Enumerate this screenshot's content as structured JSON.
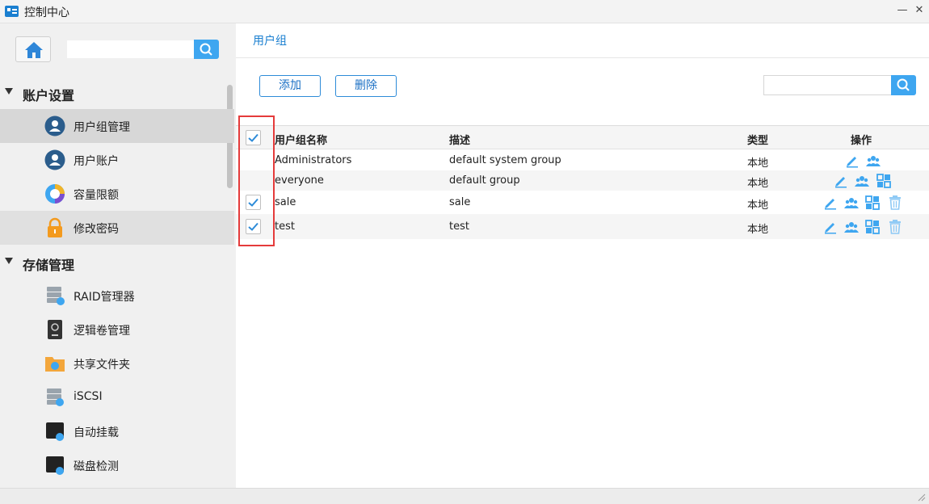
{
  "window": {
    "title": "控制中心",
    "minimize": "—",
    "close": "✕"
  },
  "sidebar": {
    "search": {
      "placeholder": ""
    },
    "sections": [
      {
        "label": "账户设置",
        "items": [
          {
            "label": "用户组管理",
            "icon": "user-group-icon",
            "state": "active"
          },
          {
            "label": "用户账户",
            "icon": "user-account-icon"
          },
          {
            "label": "容量限额",
            "icon": "quota-pie-icon"
          },
          {
            "label": "修改密码",
            "icon": "lock-icon",
            "state": "highlighted"
          }
        ]
      },
      {
        "label": "存储管理",
        "items": [
          {
            "label": "RAID管理器",
            "icon": "raid-icon"
          },
          {
            "label": "逻辑卷管理",
            "icon": "lvm-icon"
          },
          {
            "label": "共享文件夹",
            "icon": "shared-folder-icon"
          },
          {
            "label": "iSCSI",
            "icon": "iscsi-icon"
          },
          {
            "label": "自动挂载",
            "icon": "auto-mount-icon"
          },
          {
            "label": "磁盘检测",
            "icon": "disk-check-icon"
          }
        ]
      }
    ]
  },
  "main": {
    "title": "用户组",
    "buttons": {
      "add": "添加",
      "delete": "删除"
    },
    "search": {
      "placeholder": ""
    },
    "table": {
      "columns": [
        "用户组名称",
        "描述",
        "类型",
        "操作"
      ],
      "header_checked": true,
      "rows": [
        {
          "name": "Administrators",
          "desc": "default system group",
          "type": "本地",
          "checkbox": false,
          "checked": false,
          "ops": [
            "edit-icon",
            "members-icon"
          ]
        },
        {
          "name": "everyone",
          "desc": "default group",
          "type": "本地",
          "checkbox": false,
          "checked": false,
          "ops": [
            "edit-icon",
            "members-icon",
            "permissions-icon"
          ]
        },
        {
          "name": "sale",
          "desc": "sale",
          "type": "本地",
          "checkbox": true,
          "checked": true,
          "ops": [
            "edit-icon",
            "members-icon",
            "permissions-icon",
            "trash-icon"
          ]
        },
        {
          "name": "test",
          "desc": "test",
          "type": "本地",
          "checkbox": true,
          "checked": true,
          "ops": [
            "edit-icon",
            "members-icon",
            "permissions-icon",
            "trash-icon"
          ]
        }
      ]
    }
  },
  "colors": {
    "accent": "#3ea6f0",
    "link": "#1a7fd0",
    "highlight_box": "#e53b3b"
  }
}
